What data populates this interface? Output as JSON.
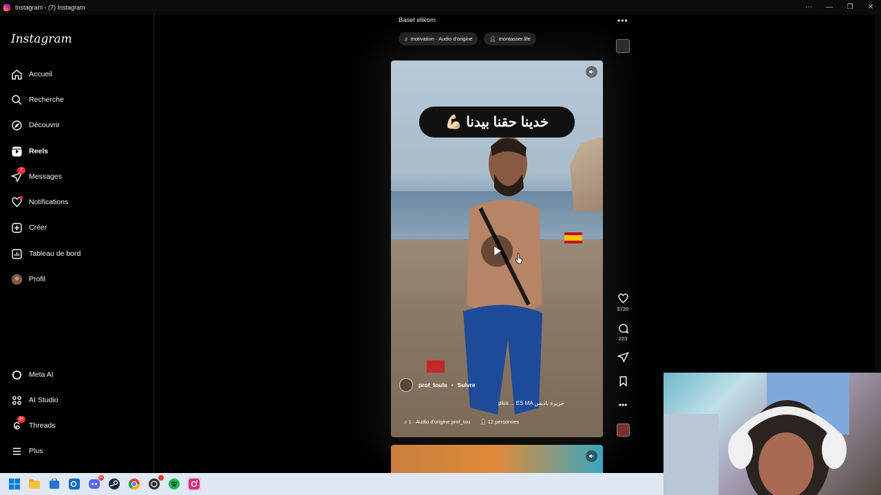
{
  "window": {
    "title": "Instagram - (7) Instagram"
  },
  "sidebar": {
    "logo": "Instagram",
    "items": [
      {
        "label": "Accueil",
        "icon": "home-icon"
      },
      {
        "label": "Recherche",
        "icon": "search-icon"
      },
      {
        "label": "Découvrir",
        "icon": "compass-icon"
      },
      {
        "label": "Reels",
        "icon": "reels-icon"
      },
      {
        "label": "Messages",
        "icon": "messages-icon",
        "badge": "7"
      },
      {
        "label": "Notifications",
        "icon": "heart-icon"
      },
      {
        "label": "Créer",
        "icon": "create-icon"
      },
      {
        "label": "Tableau de bord",
        "icon": "dashboard-icon"
      },
      {
        "label": "Profil",
        "icon": "avatar-icon"
      }
    ],
    "bottom_items": [
      {
        "label": "Meta AI",
        "icon": "meta-ai-icon"
      },
      {
        "label": "AI Studio",
        "icon": "ai-studio-icon"
      },
      {
        "label": "Threads",
        "icon": "threads-icon",
        "badge": "9+"
      },
      {
        "label": "Plus",
        "icon": "menu-icon"
      }
    ]
  },
  "previous_post": {
    "caption": "Basel elikom",
    "audio_chip": "motivation · Audio d'origine",
    "user_chip": "montasser.life"
  },
  "reel": {
    "overlay_text": "خدينا حقنا بيدنا 💪🏻",
    "author": "prof_toula",
    "follow_label": "Suivre",
    "separator": "•",
    "description": "plus ... ES MA جزيرة باديس",
    "audio": "1 · Audio d'origine  prof_tou",
    "people": "12 personnes"
  },
  "actions": {
    "likes": "5720",
    "comments": "223"
  },
  "taskbar": {
    "apps": [
      "windows-start",
      "file-explorer",
      "store",
      "outlook",
      "discord",
      "steam",
      "chrome",
      "obs",
      "spotify",
      "instagram"
    ],
    "discord_badge": "9+"
  }
}
